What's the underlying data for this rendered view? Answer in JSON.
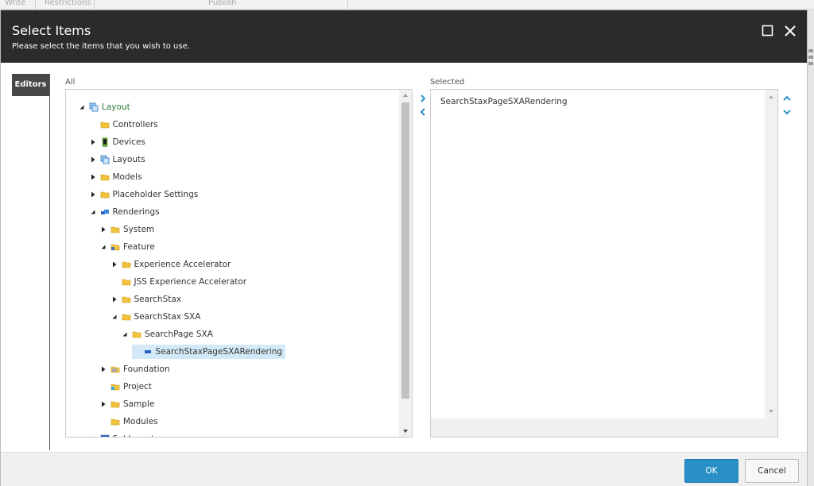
{
  "background": {
    "toolbar_labels": [
      "Write",
      "Restrictions",
      "Publish"
    ]
  },
  "dialog": {
    "title": "Select Items",
    "subtitle": "Please select the items that you wish to use.",
    "icons": {
      "maximize": "maximize-icon",
      "close": "close-icon"
    }
  },
  "tabs": [
    {
      "label": "Editors",
      "active": true
    }
  ],
  "all_panel": {
    "label": "All",
    "tree": [
      {
        "label": "Layout",
        "level": 0,
        "toggle": "expanded",
        "icon": "layout-icon",
        "root": true
      },
      {
        "label": "Controllers",
        "level": 1,
        "toggle": "none",
        "icon": "folder-icon"
      },
      {
        "label": "Devices",
        "level": 1,
        "toggle": "collapsed",
        "icon": "device-icon"
      },
      {
        "label": "Layouts",
        "level": 1,
        "toggle": "collapsed",
        "icon": "layout-icon"
      },
      {
        "label": "Models",
        "level": 1,
        "toggle": "collapsed",
        "icon": "folder-icon"
      },
      {
        "label": "Placeholder Settings",
        "level": 1,
        "toggle": "collapsed",
        "icon": "folder-icon"
      },
      {
        "label": "Renderings",
        "level": 1,
        "toggle": "expanded",
        "icon": "renderings-icon"
      },
      {
        "label": "System",
        "level": 2,
        "toggle": "collapsed",
        "icon": "folder-icon"
      },
      {
        "label": "Feature",
        "level": 2,
        "toggle": "expanded",
        "icon": "feature-folder-icon"
      },
      {
        "label": "Experience Accelerator",
        "level": 3,
        "toggle": "collapsed",
        "icon": "folder-icon"
      },
      {
        "label": "JSS Experience Accelerator",
        "level": 3,
        "toggle": "none",
        "icon": "folder-icon"
      },
      {
        "label": "SearchStax",
        "level": 3,
        "toggle": "collapsed",
        "icon": "folder-icon"
      },
      {
        "label": "SearchStax SXA",
        "level": 3,
        "toggle": "expanded",
        "icon": "folder-icon"
      },
      {
        "label": "SearchPage SXA",
        "level": 4,
        "toggle": "expanded",
        "icon": "folder-icon"
      },
      {
        "label": "SearchStaxPageSXARendering",
        "level": 5,
        "toggle": "none",
        "icon": "rendering-item-icon",
        "selected": true
      },
      {
        "label": "Foundation",
        "level": 2,
        "toggle": "collapsed",
        "icon": "foundation-folder-icon"
      },
      {
        "label": "Project",
        "level": 2,
        "toggle": "none",
        "icon": "project-folder-icon"
      },
      {
        "label": "Sample",
        "level": 2,
        "toggle": "collapsed",
        "icon": "folder-icon"
      },
      {
        "label": "Modules",
        "level": 2,
        "toggle": "none",
        "icon": "folder-icon"
      },
      {
        "label": "Sublayouts",
        "level": 1,
        "toggle": "collapsed",
        "icon": "sublayout-icon"
      }
    ]
  },
  "selected_panel": {
    "label": "Selected",
    "items": [
      "SearchStaxPageSXARendering"
    ]
  },
  "footer": {
    "ok_label": "OK",
    "cancel_label": "Cancel"
  },
  "colors": {
    "header_bg": "#2b2b2b",
    "accent": "#2b8fc7",
    "selected_row": "#d3e9f7",
    "root_text": "#2b7a3b",
    "folder": "#f3c23c"
  }
}
